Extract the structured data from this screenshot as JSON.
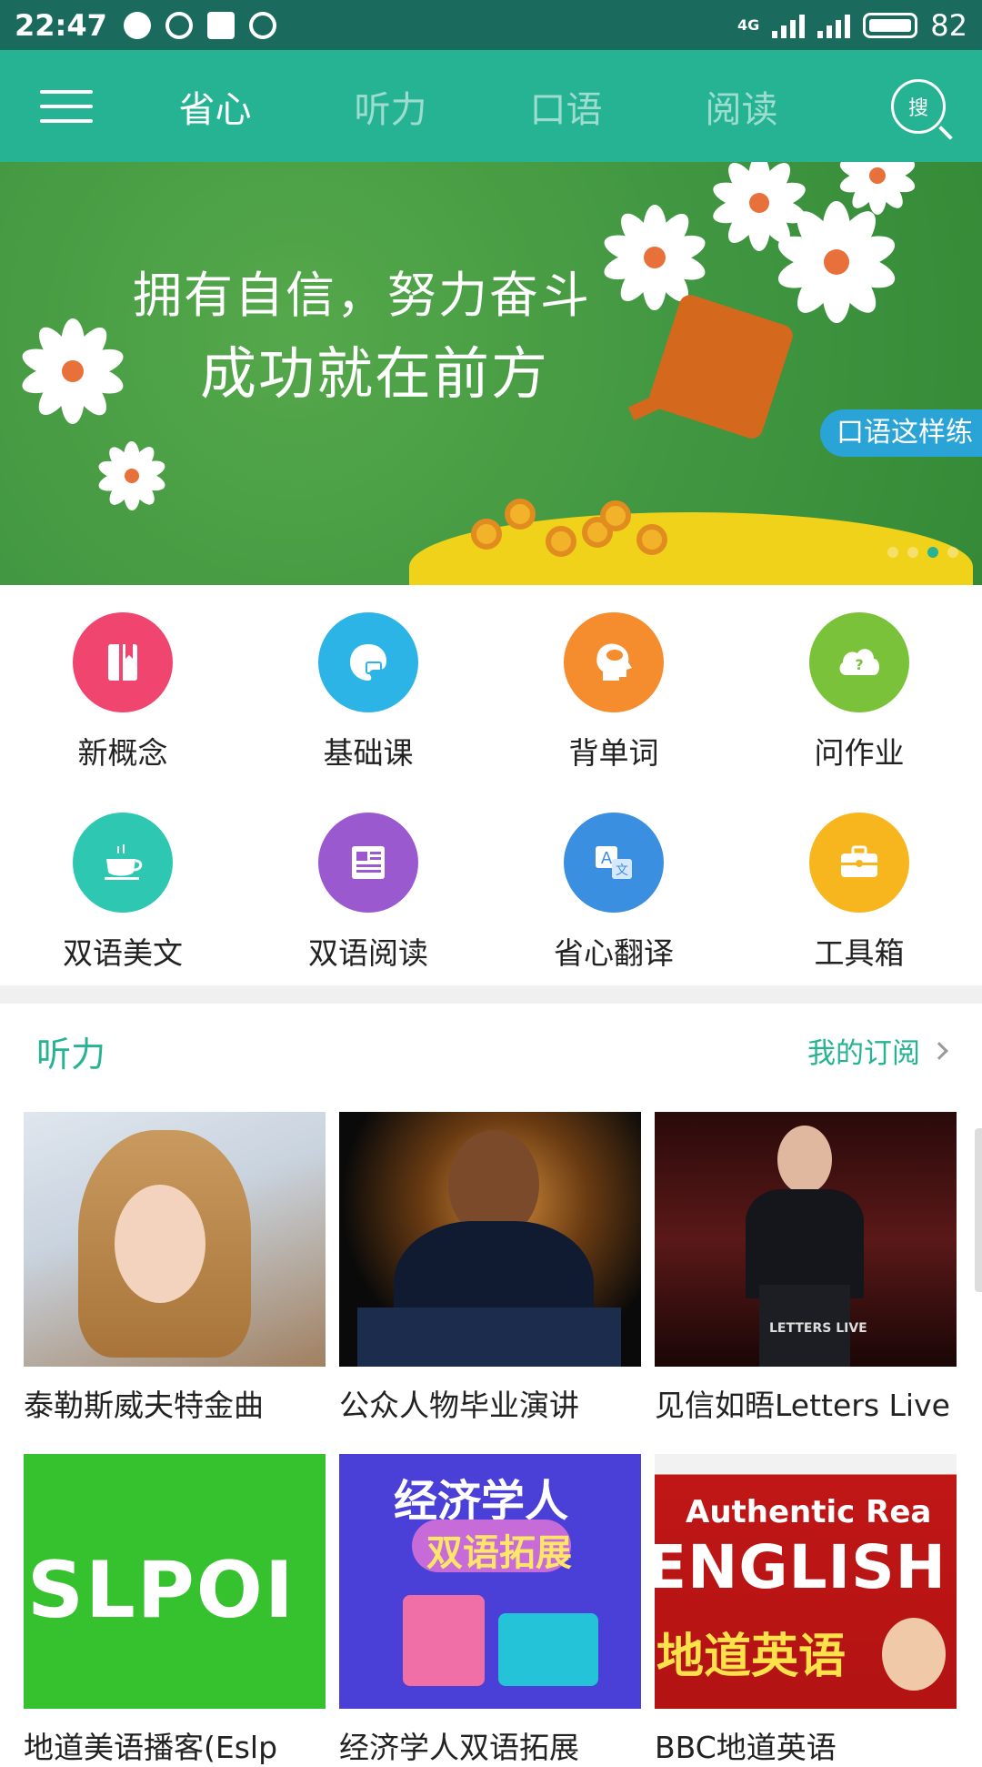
{
  "status_bar": {
    "time": "22:47",
    "network": "4G",
    "battery": "82"
  },
  "nav": {
    "tabs": [
      {
        "label": "省心",
        "active": true
      },
      {
        "label": "听力",
        "active": false
      },
      {
        "label": "口语",
        "active": false
      },
      {
        "label": "阅读",
        "active": false
      }
    ],
    "search_label": "搜"
  },
  "banner": {
    "line1": "拥有自信，努力奋斗",
    "line2": "成功就在前方",
    "tag": "口语这样练",
    "active_dot": 3,
    "dot_count": 4
  },
  "shortcuts": [
    {
      "label": "新概念",
      "color": "#f0456e",
      "icon": "book-icon"
    },
    {
      "label": "基础课",
      "color": "#2cb4e6",
      "icon": "palette-icon"
    },
    {
      "label": "背单词",
      "color": "#f58c2e",
      "icon": "head-icon"
    },
    {
      "label": "问作业",
      "color": "#79c23a",
      "icon": "question-cloud-icon"
    },
    {
      "label": "双语美文",
      "color": "#2ec8b2",
      "icon": "teacup-icon"
    },
    {
      "label": "双语阅读",
      "color": "#9b59d0",
      "icon": "newspaper-icon"
    },
    {
      "label": "省心翻译",
      "color": "#3a8fe0",
      "icon": "translate-icon"
    },
    {
      "label": "工具箱",
      "color": "#f7b61d",
      "icon": "toolbox-icon"
    }
  ],
  "section": {
    "title": "听力",
    "link": "我的订阅"
  },
  "cards": [
    {
      "title": "泰勒斯威夫特金曲",
      "thumb_text": ""
    },
    {
      "title": "公众人物毕业演讲",
      "thumb_text": ""
    },
    {
      "title": "见信如晤Letters Live",
      "thumb_text": "LETTERS LIVE"
    },
    {
      "title": "地道美语播客(Eslp",
      "thumb_text": "SLPOI"
    },
    {
      "title": "经济学人双语拓展",
      "thumb_text": "经济学人",
      "thumb_text2": "双语拓展"
    },
    {
      "title": "BBC地道英语",
      "thumb_text": "Authentic Rea",
      "thumb_text2": "ENGLISH",
      "thumb_text3": "地道英语"
    }
  ]
}
